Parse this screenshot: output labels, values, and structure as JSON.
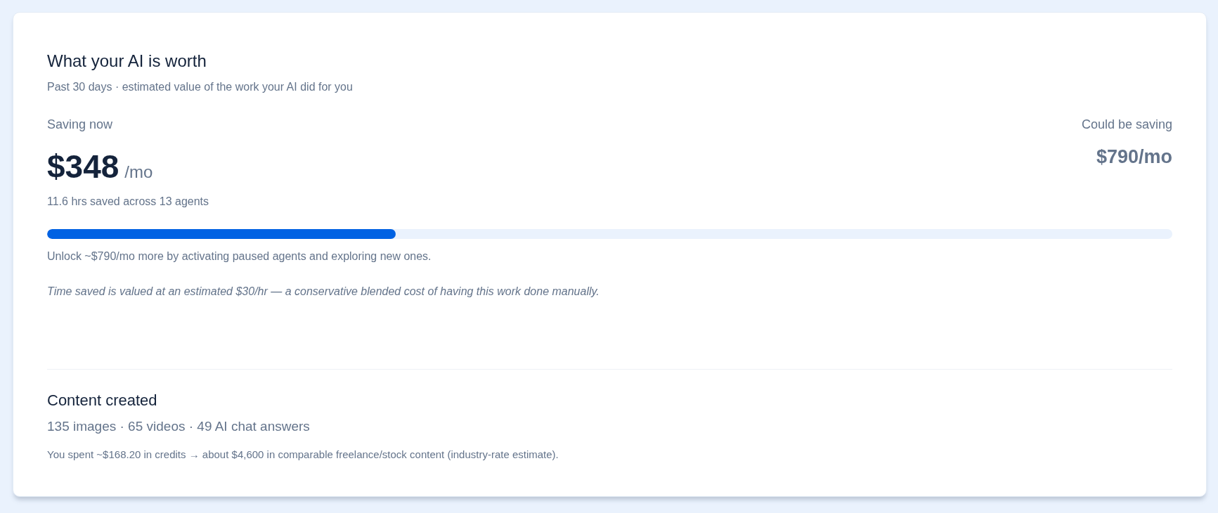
{
  "title": "What your AI is worth",
  "subtitle": "Past 30 days · estimated value of the work your AI did for you",
  "saving_now": {
    "label": "Saving now",
    "amount": "$348",
    "unit": "/mo",
    "detail": "11.6 hrs saved across 13 agents"
  },
  "could_be_saving": {
    "label": "Could be saving",
    "amount": "$790/mo"
  },
  "progress": {
    "level": 0.31
  },
  "unlock_note": "Unlock ~$790/mo more by activating paused agents and exploring new ones.",
  "valuation_note": "Time saved is valued at an estimated $30/hr — a conservative blended cost of having this work done manually.",
  "content_created": {
    "title": "Content created",
    "counts": "135 images · 65 videos · 49 AI chat answers",
    "note": "You spent ~$168.20 in credits → about $4,600 in comparable freelance/stock content (industry-rate estimate)."
  }
}
